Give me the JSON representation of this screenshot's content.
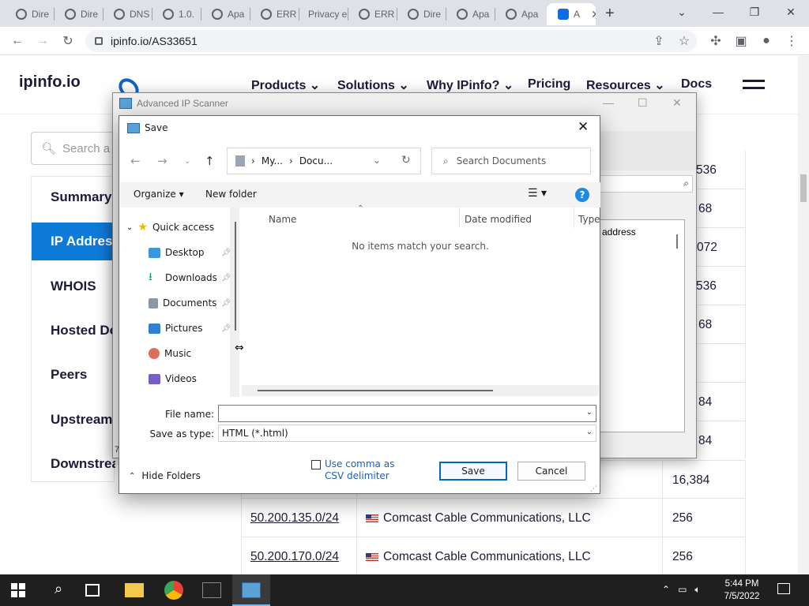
{
  "browser": {
    "tabs": [
      {
        "label": "Dire"
      },
      {
        "label": "Dire"
      },
      {
        "label": "DNS"
      },
      {
        "label": "1.0."
      },
      {
        "label": "Apa"
      },
      {
        "label": "ERR"
      },
      {
        "label": "Privacy e"
      },
      {
        "label": "ERR"
      },
      {
        "label": "Dire"
      },
      {
        "label": "Apa"
      },
      {
        "label": "Apa"
      },
      {
        "label": "A"
      }
    ],
    "new_tab": "+",
    "url": "ipinfo.io/AS33651"
  },
  "site": {
    "logo_text": "ipinfo.io",
    "nav": [
      "Products",
      "Solutions",
      "Why IPinfo?",
      "Pricing",
      "Resources",
      "Docs"
    ],
    "search_placeholder": "Search a",
    "side_nav": [
      "Summary",
      "IP Address",
      "WHOIS",
      "Hosted Do",
      "Peers",
      "Upstream",
      "Downstrea"
    ],
    "table_rows": [
      {
        "range": "",
        "company": "",
        "count": "16,384"
      },
      {
        "range": "50.200.135.0/24",
        "company": "Comcast Cable Communications, LLC",
        "count": "256"
      },
      {
        "range": "50.200.170.0/24",
        "company": "Comcast Cable Communications, LLC",
        "count": "256"
      }
    ],
    "partial_counts": [
      "536",
      "68",
      "072",
      "536",
      "68",
      "",
      "84",
      "84"
    ]
  },
  "scanner": {
    "title": "Advanced IP Scanner",
    "results_column": "address",
    "status_text": "7"
  },
  "save_dialog": {
    "title": "Save",
    "breadcrumb": [
      "My...",
      "Docu..."
    ],
    "search_placeholder": "Search Documents",
    "organize": "Organize",
    "new_folder": "New folder",
    "help": "?",
    "tree": [
      {
        "label": "Quick access",
        "icon": "star-icon",
        "color": "#f4b400"
      },
      {
        "label": "Desktop",
        "icon": "desktop-icon",
        "color": "#3a96dd"
      },
      {
        "label": "Downloads",
        "icon": "download-icon",
        "color": "#1e9b5f"
      },
      {
        "label": "Documents",
        "icon": "document-icon",
        "color": "#8a97a5"
      },
      {
        "label": "Pictures",
        "icon": "pictures-icon",
        "color": "#2f80d0"
      },
      {
        "label": "Music",
        "icon": "music-icon",
        "color": "#e06c5a"
      },
      {
        "label": "Videos",
        "icon": "video-icon",
        "color": "#7b5cc4"
      }
    ],
    "columns": [
      "Name",
      "Date modified",
      "Type"
    ],
    "empty_message": "No items match your search.",
    "file_name_label": "File name:",
    "file_name_value": "",
    "save_type_label": "Save as type:",
    "save_type_value": "HTML (*.html)",
    "csv_option": "Use comma as CSV delimiter",
    "hide_folders": "Hide Folders",
    "save_button": "Save",
    "cancel_button": "Cancel"
  },
  "taskbar": {
    "time": "5:44 PM",
    "date": "7/5/2022"
  }
}
